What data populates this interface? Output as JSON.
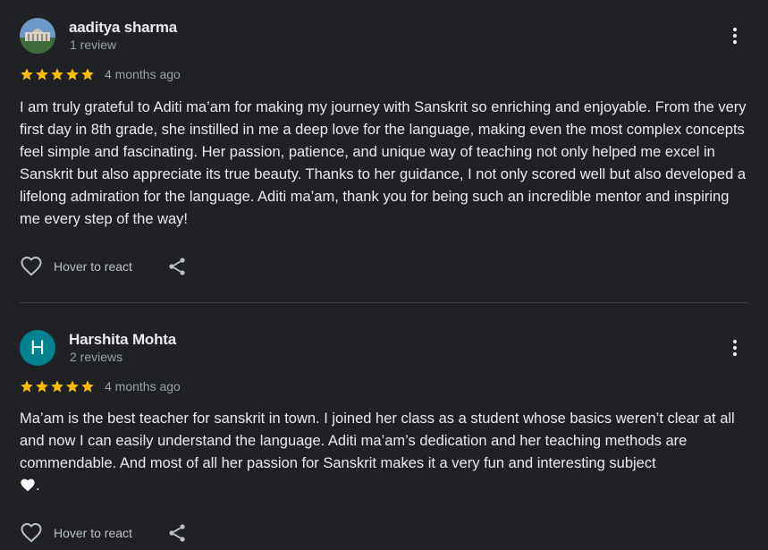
{
  "reviews": [
    {
      "author": "aaditya sharma",
      "author_meta": "1 review",
      "avatar": "photo-avatar",
      "rating": 5,
      "date": "4 months ago",
      "text": "I am truly grateful to Aditi ma’am for making my journey with Sanskrit so enriching and enjoyable. From the very first day in 8th grade, she instilled in me a deep love for the language, making even the most complex concepts feel simple and fascinating. Her passion, patience, and unique way of teaching not only helped me excel in Sanskrit but also appreciate its true beauty. Thanks to her guidance, I not only scored well but also developed a lifelong admiration for the language. Aditi ma’am, thank you for being such an incredible mentor and inspiring me every step of the way!",
      "react_label": "Hover to react"
    },
    {
      "author": "Harshita Mohta",
      "author_meta": "2 reviews",
      "avatar_letter": "H",
      "rating": 5,
      "date": "4 months ago",
      "text": "Ma’am is the best teacher for sanskrit in town. I joined her class as a student whose basics weren’t clear at all and now I can easily understand the language. Aditi ma’am’s dedication and her teaching methods are commendable. And most of all her passion for Sanskrit makes it a very fun and interesting subject",
      "text_end": ".",
      "react_label": "Hover to react"
    }
  ],
  "colors": {
    "background": "#202124",
    "star": "#fbbc04",
    "avatar_letter_bg": "#00838f",
    "secondary_text": "#9aa0a6"
  },
  "icons": [
    "more-vert-icon",
    "star-icon",
    "heart-outline-icon",
    "share-icon",
    "white-heart-emoji"
  ]
}
